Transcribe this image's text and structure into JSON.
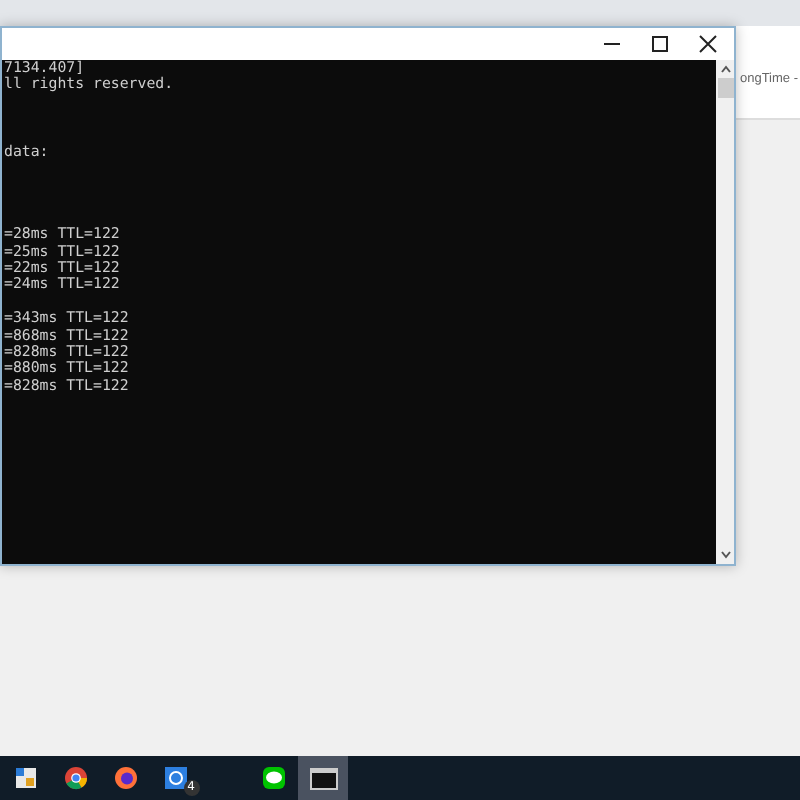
{
  "background_window": {
    "tab_text": "ongTime -"
  },
  "console": {
    "lines": [
      {
        "kind": "text",
        "text": "7134.407]"
      },
      {
        "kind": "text",
        "text": "ll rights reserved."
      },
      {
        "kind": "blank"
      },
      {
        "kind": "blank"
      },
      {
        "kind": "blank"
      },
      {
        "kind": "text",
        "text": "data:"
      },
      {
        "kind": "blank"
      },
      {
        "kind": "blank"
      },
      {
        "kind": "blank"
      },
      {
        "kind": "blank"
      },
      {
        "kind": "text",
        "text": "=28ms TTL=122"
      },
      {
        "kind": "text",
        "text": "=25ms TTL=122"
      },
      {
        "kind": "text",
        "text": "=22ms TTL=122"
      },
      {
        "kind": "text",
        "text": "=24ms TTL=122"
      },
      {
        "kind": "blank"
      },
      {
        "kind": "text",
        "text": "=343ms TTL=122"
      },
      {
        "kind": "text",
        "text": "=868ms TTL=122"
      },
      {
        "kind": "text",
        "text": "=828ms TTL=122"
      },
      {
        "kind": "text",
        "text": "=880ms TTL=122"
      },
      {
        "kind": "text",
        "text": "=828ms TTL=122"
      }
    ]
  },
  "taskbar": {
    "items": [
      {
        "kind": "app",
        "selected": false
      },
      {
        "kind": "chrome",
        "selected": false
      },
      {
        "kind": "firefox",
        "selected": false
      },
      {
        "kind": "blue",
        "selected": false,
        "badge": "4"
      },
      {
        "kind": "chat",
        "selected": false
      },
      {
        "kind": "terminal",
        "selected": true
      }
    ]
  }
}
